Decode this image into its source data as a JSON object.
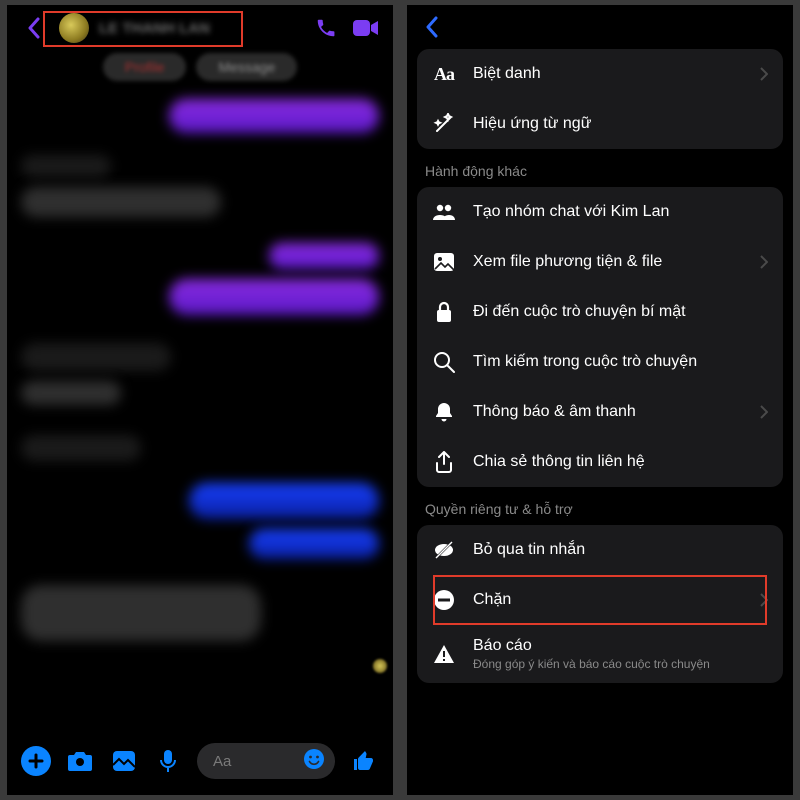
{
  "left": {
    "contact_name": "LE THANH LAN",
    "pill_profile": "Profile",
    "pill_message": "Message",
    "input_placeholder": "Aa"
  },
  "right": {
    "top": {
      "nicknames": "Biệt danh",
      "word_effects": "Hiệu ứng từ ngữ"
    },
    "section_more": "Hành động khác",
    "more": {
      "create_group": "Tạo nhóm chat với Kim Lan",
      "view_media": "Xem file phương tiện & file",
      "secret_chat": "Đi đến cuộc trò chuyện bí mật",
      "search": "Tìm kiếm trong cuộc trò chuyện",
      "notifications": "Thông báo & âm thanh",
      "share_contact": "Chia sẻ thông tin liên hệ"
    },
    "section_privacy": "Quyền riêng tư & hỗ trợ",
    "privacy": {
      "ignore": "Bỏ qua tin nhắn",
      "block": "Chặn",
      "report": "Báo cáo",
      "report_sub": "Đóng góp ý kiến và báo cáo cuộc trò chuyện"
    }
  }
}
